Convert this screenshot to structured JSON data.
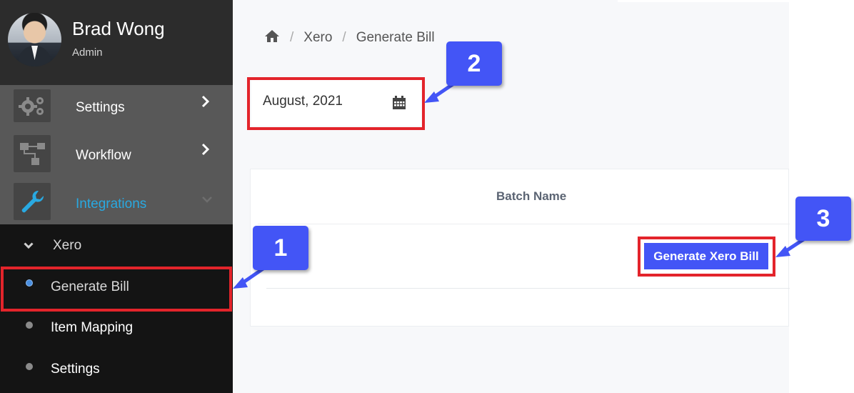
{
  "profile": {
    "name": "Brad Wong",
    "role": "Admin"
  },
  "menu": [
    {
      "label": "Settings",
      "icon": "gears-icon"
    },
    {
      "label": "Workflow",
      "icon": "workflow-icon"
    },
    {
      "label": "Integrations",
      "icon": "wrench-icon",
      "active": true
    }
  ],
  "submenu": {
    "parent": "Xero",
    "items": [
      {
        "label": "Generate Bill",
        "active": true
      },
      {
        "label": "Item Mapping"
      },
      {
        "label": "Settings"
      }
    ]
  },
  "breadcrumb": {
    "home_icon": "home-icon",
    "items": [
      "Xero",
      "Generate Bill"
    ]
  },
  "date_picker": {
    "value": "August, 2021",
    "icon": "calendar-icon"
  },
  "table": {
    "columns": [
      "Batch Name"
    ]
  },
  "generate_button": {
    "label": "Generate Xero Bill"
  },
  "annotations": {
    "badges": [
      "1",
      "2",
      "3"
    ]
  },
  "colors": {
    "accent": "#4355f6",
    "highlight": "#e3242b",
    "active_link": "#29a9e1",
    "sidebar": "#141414"
  }
}
